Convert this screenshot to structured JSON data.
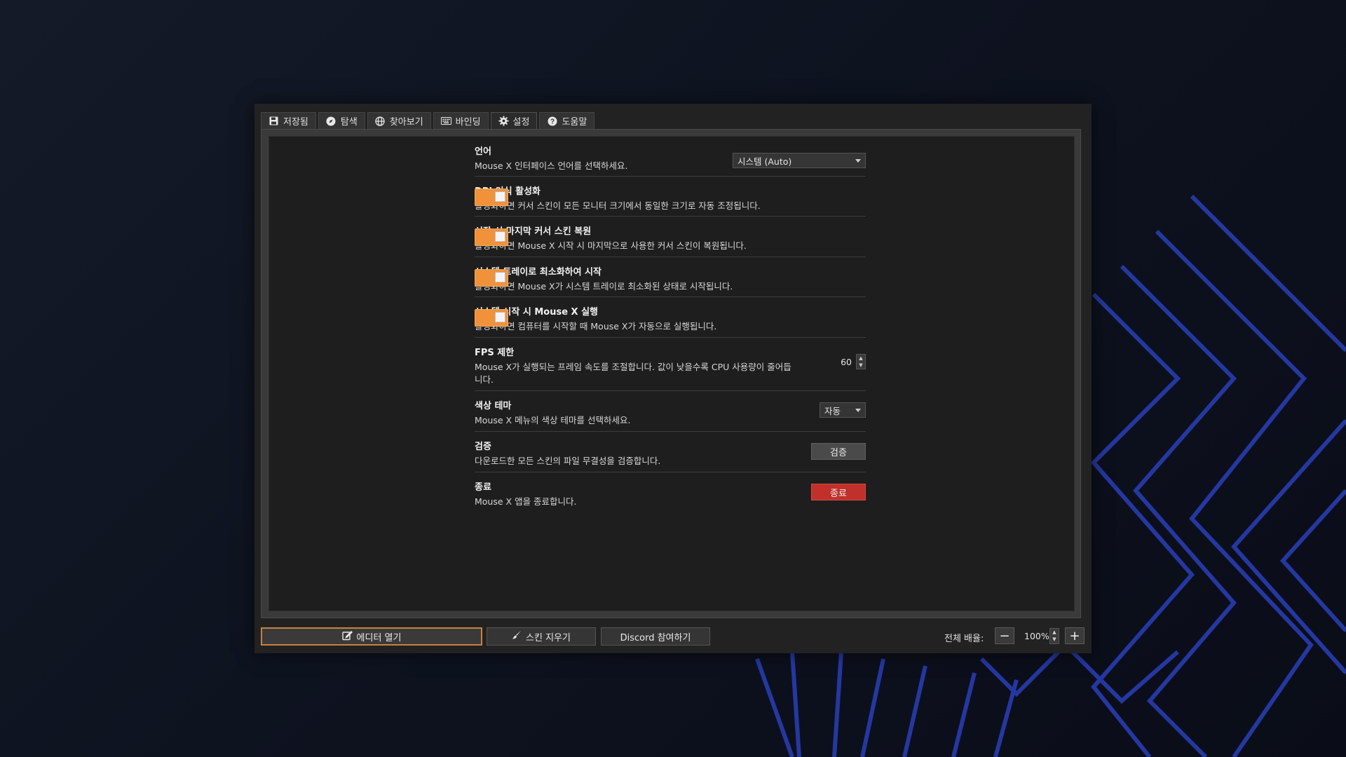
{
  "tabs": [
    {
      "label": "저장됨",
      "icon": "save-icon"
    },
    {
      "label": "탐색",
      "icon": "compass-icon"
    },
    {
      "label": "찾아보기",
      "icon": "globe-icon"
    },
    {
      "label": "바인딩",
      "icon": "keyboard-icon"
    },
    {
      "label": "설정",
      "icon": "gear-icon",
      "active": true
    },
    {
      "label": "도움말",
      "icon": "help-icon"
    }
  ],
  "settings": {
    "language": {
      "title": "언어",
      "desc": "Mouse X 인터페이스 언어를 선택하세요.",
      "value": "시스템 (Auto)"
    },
    "dpi": {
      "title": "DPI 인식 활성화",
      "desc": "활성화하면 커서 스킨이 모든 모니터 크기에서 동일한 크기로 자동 조정됩니다.",
      "on": true
    },
    "restore": {
      "title": "시작 시 마지막 커서 스킨 복원",
      "desc": "활성화하면 Mouse X 시작 시 마지막으로 사용한 커서 스킨이 복원됩니다.",
      "on": true
    },
    "tray": {
      "title": "시스템 트레이로 최소화하여 시작",
      "desc": "활성화하면 Mouse X가 시스템 트레이로 최소화된 상태로 시작됩니다.",
      "on": true
    },
    "autostart": {
      "title": "시스템 시작 시 Mouse X 실행",
      "desc": "활성화하면 컴퓨터를 시작할 때 Mouse X가 자동으로 실행됩니다.",
      "on": true
    },
    "fps": {
      "title": "FPS 제한",
      "desc": "Mouse X가 실행되는 프레임 속도를 조절합니다. 값이 낮을수록 CPU 사용량이 줄어듭니다.",
      "value": "60"
    },
    "theme": {
      "title": "색상 테마",
      "desc": "Mouse X 메뉴의 색상 테마를 선택하세요.",
      "value": "자동"
    },
    "verify": {
      "title": "검증",
      "desc": "다운로드한 모든 스킨의 파일 무결성을 검증합니다.",
      "button": "검증"
    },
    "quit": {
      "title": "종료",
      "desc": "Mouse X 앱을 종료합니다.",
      "button": "종료"
    }
  },
  "bottom": {
    "open_editor": "에디터 열기",
    "clear_skin": "스킨 지우기",
    "discord": "Discord 참여하기",
    "zoom_label": "전체 배율:",
    "zoom_value": "100%"
  },
  "colors": {
    "accent": "#f0923a",
    "danger": "#c0312b",
    "background": "#222222"
  }
}
